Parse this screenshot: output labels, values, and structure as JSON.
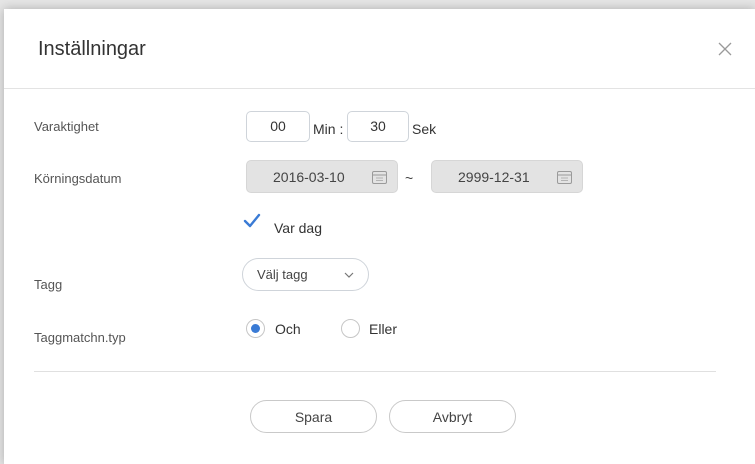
{
  "dialog": {
    "title": "Inställningar",
    "close_icon": "close-icon"
  },
  "duration": {
    "label": "Varaktighet",
    "minutes": "00",
    "min_unit": "Min :",
    "seconds": "30",
    "sec_unit": "Sek"
  },
  "run_date": {
    "label": "Körningsdatum",
    "start": "2016-03-10",
    "separator": "~",
    "end": "2999-12-31",
    "calendar_icon": "calendar-icon"
  },
  "every_day": {
    "label": "Var dag",
    "checked": true
  },
  "tag": {
    "label": "Tagg",
    "select_text": "Välj tagg",
    "chevron_icon": "chevron-down-icon"
  },
  "tag_match": {
    "label": "Taggmatchn.typ",
    "options": [
      "Och",
      "Eller"
    ],
    "selected": "Och"
  },
  "buttons": {
    "save": "Spara",
    "cancel": "Avbryt"
  },
  "colors": {
    "accent": "#3a7bd5",
    "date_background": "#e3e3e3"
  }
}
